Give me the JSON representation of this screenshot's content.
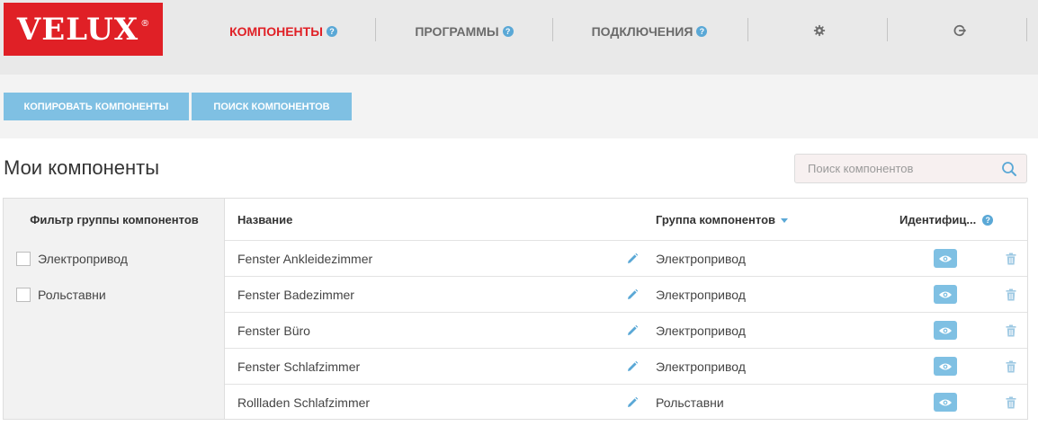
{
  "logo": {
    "text": "VELUX",
    "reg": "®"
  },
  "nav": {
    "components": "КОМПОНЕНТЫ",
    "programs": "ПРОГРАММЫ",
    "connections": "ПОДКЛЮЧЕНИЯ",
    "help_glyph": "?"
  },
  "toolbar": {
    "copy_label": "КОПИРОВАТЬ КОМПОНЕНТЫ",
    "search_label": "ПОИСК КОМПОНЕНТОВ"
  },
  "page": {
    "title": "Мои компоненты"
  },
  "search": {
    "placeholder": "Поиск компонентов"
  },
  "filter": {
    "title": "Фильтр группы компонентов",
    "options": [
      "Электропривод",
      "Рольставни"
    ]
  },
  "table": {
    "columns": {
      "name": "Название",
      "group": "Группа компонентов",
      "ident": "Идентифиц..."
    },
    "rows": [
      {
        "name": "Fenster Ankleidezimmer",
        "group": "Электропривод"
      },
      {
        "name": "Fenster Badezimmer",
        "group": "Электропривод"
      },
      {
        "name": "Fenster Büro",
        "group": "Электропривод"
      },
      {
        "name": "Fenster Schlafzimmer",
        "group": "Электропривод"
      },
      {
        "name": "Rollladen Schlafzimmer",
        "group": "Рольставни"
      }
    ]
  },
  "colors": {
    "brand": "#e02026",
    "accent": "#7fc0e3",
    "help": "#5aa8d6"
  },
  "icons": [
    "gear-icon",
    "logout-icon",
    "search-icon",
    "pencil-icon",
    "eye-icon",
    "trash-icon",
    "sort-down-icon"
  ]
}
